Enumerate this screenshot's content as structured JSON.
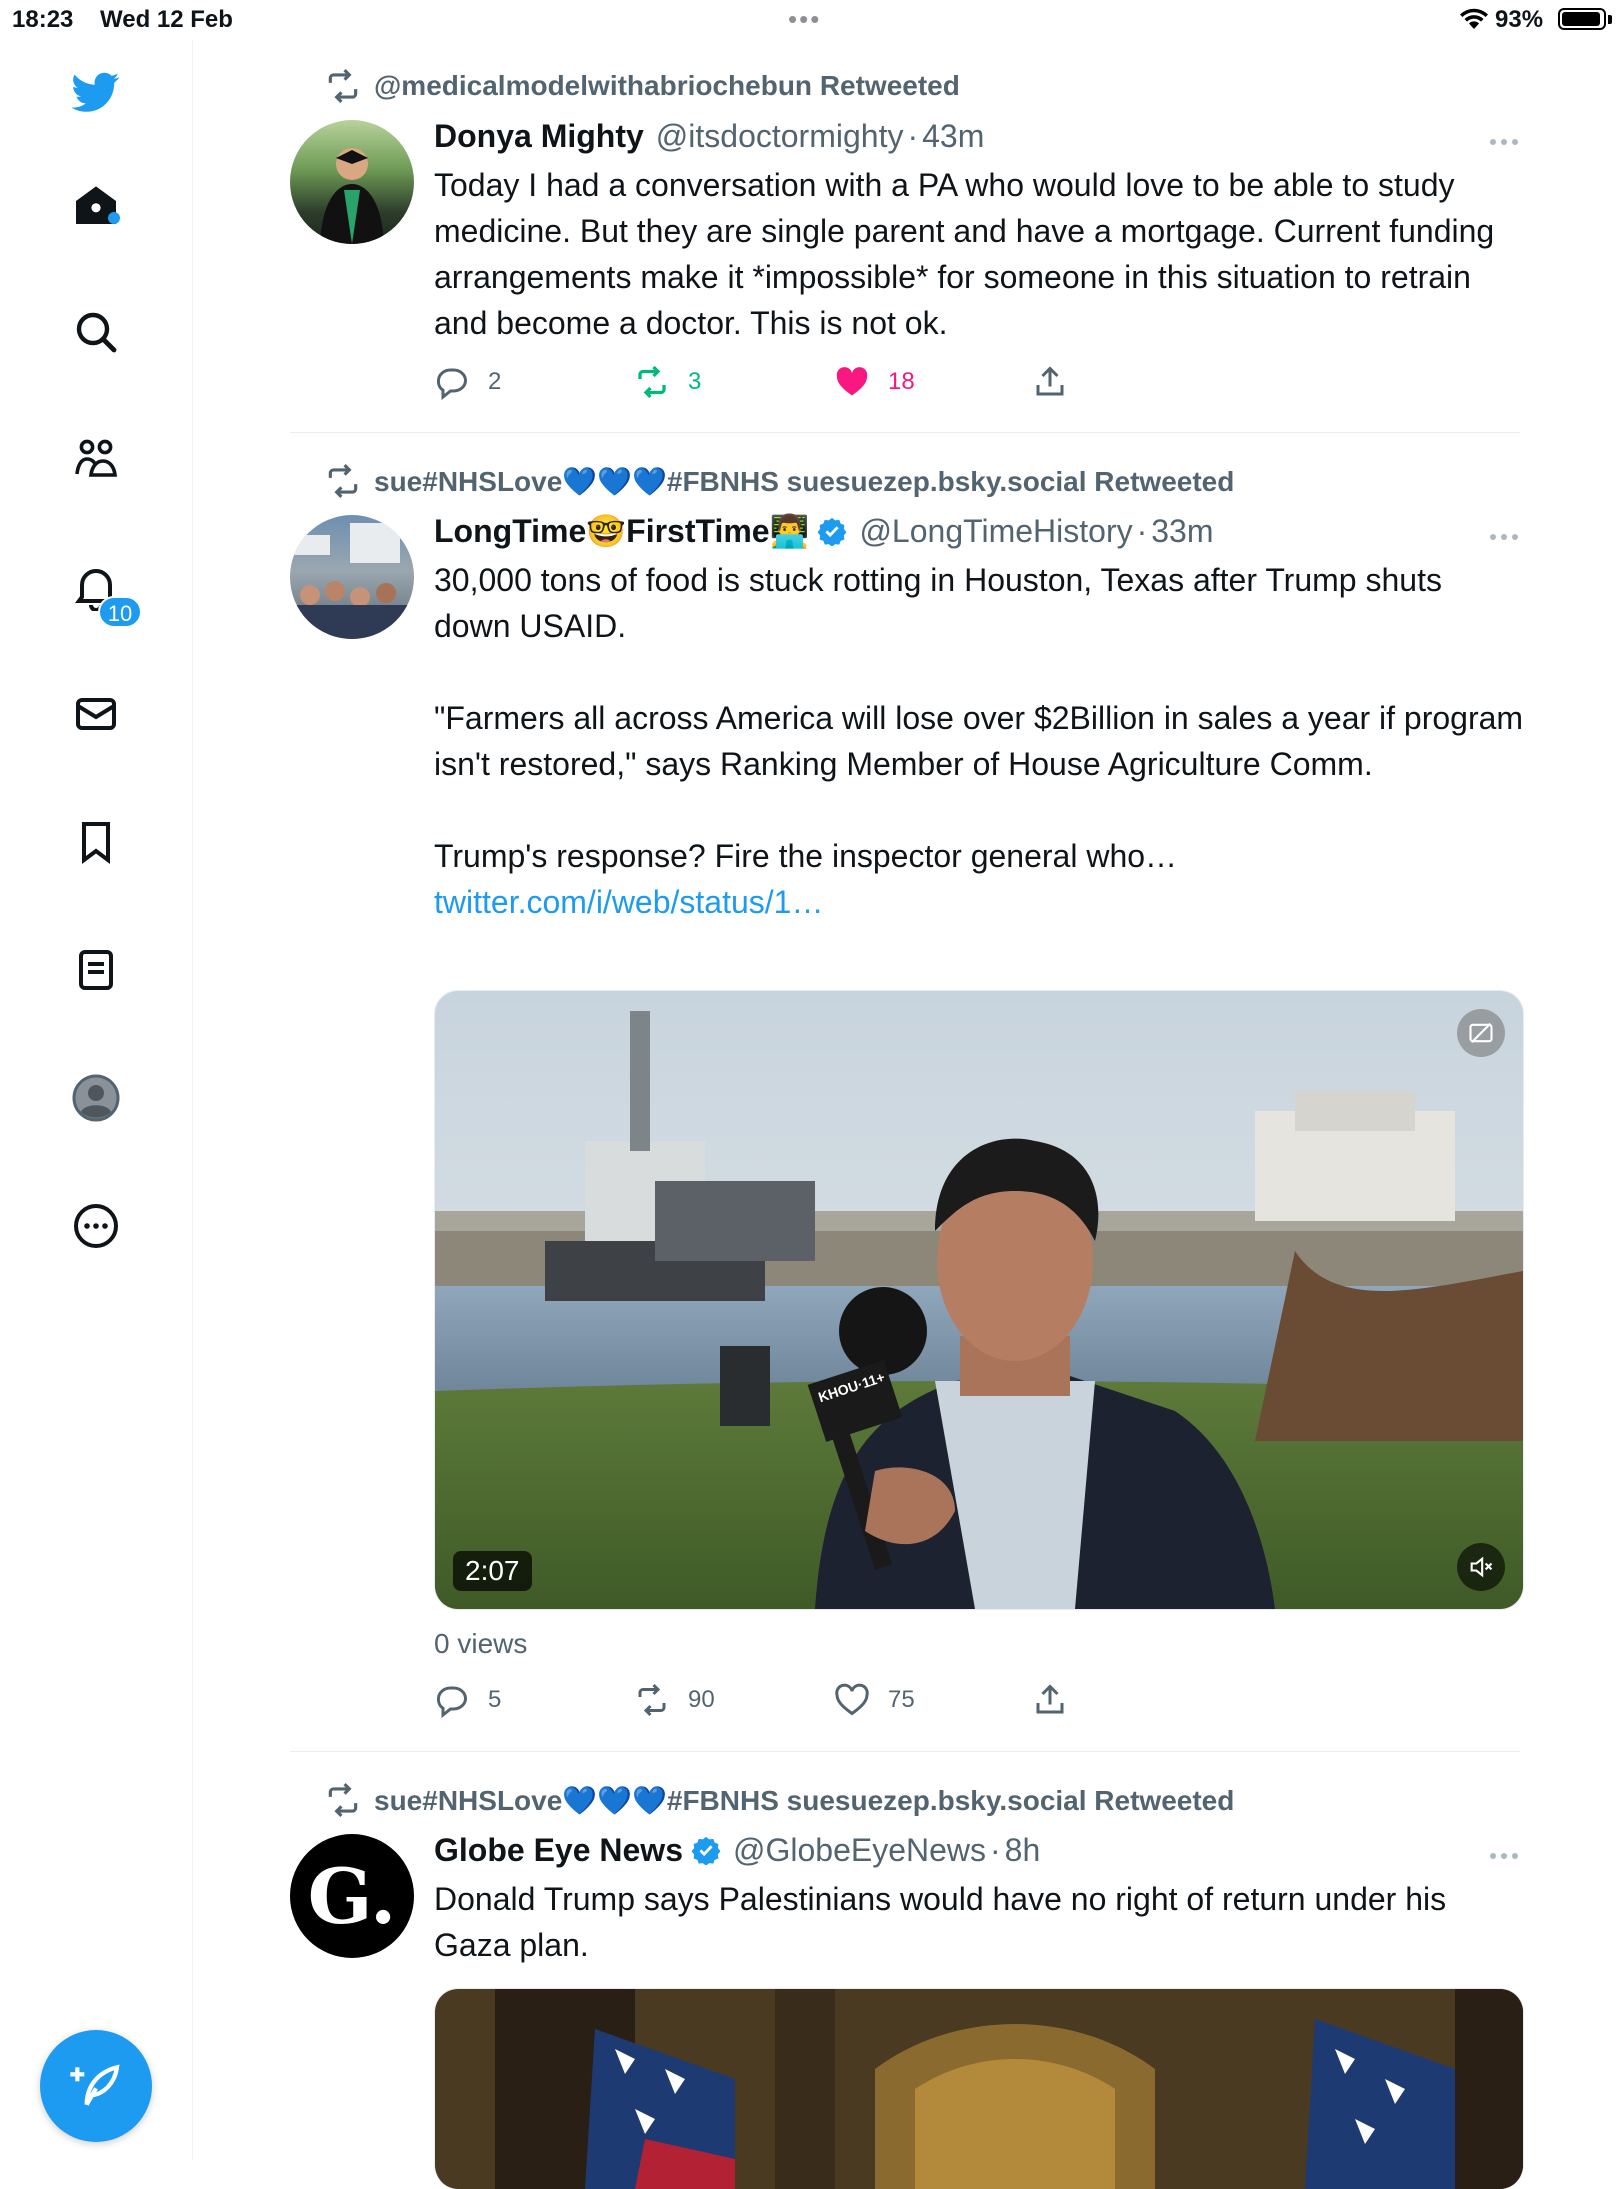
{
  "status_bar": {
    "time": "18:23",
    "date": "Wed 12 Feb",
    "battery": "93%"
  },
  "sidebar": {
    "items": [
      {
        "name": "logo"
      },
      {
        "name": "home"
      },
      {
        "name": "explore"
      },
      {
        "name": "communities"
      },
      {
        "name": "notifications"
      },
      {
        "name": "messages"
      },
      {
        "name": "bookmarks"
      },
      {
        "name": "lists"
      },
      {
        "name": "profile"
      },
      {
        "name": "more"
      }
    ],
    "notification_count": "10"
  },
  "tweets": [
    {
      "retweeted_by": "@medicalmodelwithabriochebun Retweeted",
      "name": "Donya Mighty",
      "handle": "@itsdoctormighty",
      "time": "43m",
      "text": "Today I had a conversation with a PA who would love to be able to study medicine. But they are single parent and have a mortgage. Current funding arrangements make it *impossible* for someone in this situation to retrain and become a doctor. This is not ok.",
      "replies": "2",
      "retweets": "3",
      "likes": "18"
    },
    {
      "retweeted_by": "sue#NHSLove💙💙💙#FBNHS suesuezep.bsky.social Retweeted",
      "name": "LongTime🤓FirstTime👨‍💻",
      "handle": "@LongTimeHistory",
      "time": "33m",
      "text_main": "30,000 tons of food is stuck rotting in Houston, Texas after Trump shuts down USAID.\n\n\"Farmers all across America will lose over $2Billion in sales a year if program isn't restored,\" says Ranking Member of House Agriculture Comm.\n\nTrump's response? Fire the inspector general who… ",
      "link": "twitter.com/i/web/status/1…",
      "video_duration": "2:07",
      "mic_label": "KHOU·11+",
      "views": "0 views",
      "replies": "5",
      "retweets": "90",
      "likes": "75"
    },
    {
      "retweeted_by": "sue#NHSLove💙💙💙#FBNHS suesuezep.bsky.social Retweeted",
      "name": "Globe Eye News",
      "handle": "@GlobeEyeNews",
      "time": "8h",
      "text": "Donald Trump says Palestinians would have no right of return under his Gaza plan.",
      "avatar_letter": "G."
    }
  ],
  "colors": {
    "accent": "#1d9bf0",
    "retweet_green": "#00ba7c",
    "like_pink": "#f91880",
    "muted": "#536471"
  }
}
